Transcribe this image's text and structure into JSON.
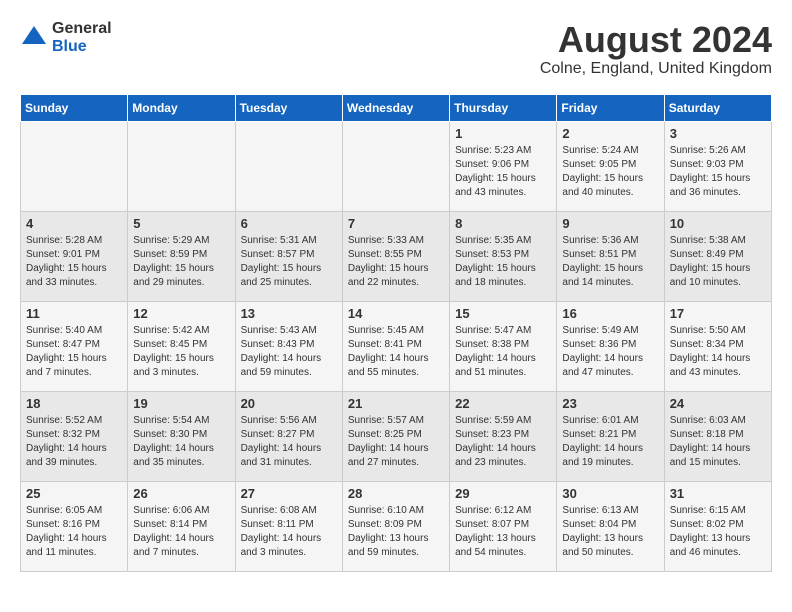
{
  "header": {
    "logo_general": "General",
    "logo_blue": "Blue",
    "month_year": "August 2024",
    "location": "Colne, England, United Kingdom"
  },
  "weekdays": [
    "Sunday",
    "Monday",
    "Tuesday",
    "Wednesday",
    "Thursday",
    "Friday",
    "Saturday"
  ],
  "weeks": [
    [
      {
        "day": "",
        "info": ""
      },
      {
        "day": "",
        "info": ""
      },
      {
        "day": "",
        "info": ""
      },
      {
        "day": "",
        "info": ""
      },
      {
        "day": "1",
        "info": "Sunrise: 5:23 AM\nSunset: 9:06 PM\nDaylight: 15 hours\nand 43 minutes."
      },
      {
        "day": "2",
        "info": "Sunrise: 5:24 AM\nSunset: 9:05 PM\nDaylight: 15 hours\nand 40 minutes."
      },
      {
        "day": "3",
        "info": "Sunrise: 5:26 AM\nSunset: 9:03 PM\nDaylight: 15 hours\nand 36 minutes."
      }
    ],
    [
      {
        "day": "4",
        "info": "Sunrise: 5:28 AM\nSunset: 9:01 PM\nDaylight: 15 hours\nand 33 minutes."
      },
      {
        "day": "5",
        "info": "Sunrise: 5:29 AM\nSunset: 8:59 PM\nDaylight: 15 hours\nand 29 minutes."
      },
      {
        "day": "6",
        "info": "Sunrise: 5:31 AM\nSunset: 8:57 PM\nDaylight: 15 hours\nand 25 minutes."
      },
      {
        "day": "7",
        "info": "Sunrise: 5:33 AM\nSunset: 8:55 PM\nDaylight: 15 hours\nand 22 minutes."
      },
      {
        "day": "8",
        "info": "Sunrise: 5:35 AM\nSunset: 8:53 PM\nDaylight: 15 hours\nand 18 minutes."
      },
      {
        "day": "9",
        "info": "Sunrise: 5:36 AM\nSunset: 8:51 PM\nDaylight: 15 hours\nand 14 minutes."
      },
      {
        "day": "10",
        "info": "Sunrise: 5:38 AM\nSunset: 8:49 PM\nDaylight: 15 hours\nand 10 minutes."
      }
    ],
    [
      {
        "day": "11",
        "info": "Sunrise: 5:40 AM\nSunset: 8:47 PM\nDaylight: 15 hours\nand 7 minutes."
      },
      {
        "day": "12",
        "info": "Sunrise: 5:42 AM\nSunset: 8:45 PM\nDaylight: 15 hours\nand 3 minutes."
      },
      {
        "day": "13",
        "info": "Sunrise: 5:43 AM\nSunset: 8:43 PM\nDaylight: 14 hours\nand 59 minutes."
      },
      {
        "day": "14",
        "info": "Sunrise: 5:45 AM\nSunset: 8:41 PM\nDaylight: 14 hours\nand 55 minutes."
      },
      {
        "day": "15",
        "info": "Sunrise: 5:47 AM\nSunset: 8:38 PM\nDaylight: 14 hours\nand 51 minutes."
      },
      {
        "day": "16",
        "info": "Sunrise: 5:49 AM\nSunset: 8:36 PM\nDaylight: 14 hours\nand 47 minutes."
      },
      {
        "day": "17",
        "info": "Sunrise: 5:50 AM\nSunset: 8:34 PM\nDaylight: 14 hours\nand 43 minutes."
      }
    ],
    [
      {
        "day": "18",
        "info": "Sunrise: 5:52 AM\nSunset: 8:32 PM\nDaylight: 14 hours\nand 39 minutes."
      },
      {
        "day": "19",
        "info": "Sunrise: 5:54 AM\nSunset: 8:30 PM\nDaylight: 14 hours\nand 35 minutes."
      },
      {
        "day": "20",
        "info": "Sunrise: 5:56 AM\nSunset: 8:27 PM\nDaylight: 14 hours\nand 31 minutes."
      },
      {
        "day": "21",
        "info": "Sunrise: 5:57 AM\nSunset: 8:25 PM\nDaylight: 14 hours\nand 27 minutes."
      },
      {
        "day": "22",
        "info": "Sunrise: 5:59 AM\nSunset: 8:23 PM\nDaylight: 14 hours\nand 23 minutes."
      },
      {
        "day": "23",
        "info": "Sunrise: 6:01 AM\nSunset: 8:21 PM\nDaylight: 14 hours\nand 19 minutes."
      },
      {
        "day": "24",
        "info": "Sunrise: 6:03 AM\nSunset: 8:18 PM\nDaylight: 14 hours\nand 15 minutes."
      }
    ],
    [
      {
        "day": "25",
        "info": "Sunrise: 6:05 AM\nSunset: 8:16 PM\nDaylight: 14 hours\nand 11 minutes."
      },
      {
        "day": "26",
        "info": "Sunrise: 6:06 AM\nSunset: 8:14 PM\nDaylight: 14 hours\nand 7 minutes."
      },
      {
        "day": "27",
        "info": "Sunrise: 6:08 AM\nSunset: 8:11 PM\nDaylight: 14 hours\nand 3 minutes."
      },
      {
        "day": "28",
        "info": "Sunrise: 6:10 AM\nSunset: 8:09 PM\nDaylight: 13 hours\nand 59 minutes."
      },
      {
        "day": "29",
        "info": "Sunrise: 6:12 AM\nSunset: 8:07 PM\nDaylight: 13 hours\nand 54 minutes."
      },
      {
        "day": "30",
        "info": "Sunrise: 6:13 AM\nSunset: 8:04 PM\nDaylight: 13 hours\nand 50 minutes."
      },
      {
        "day": "31",
        "info": "Sunrise: 6:15 AM\nSunset: 8:02 PM\nDaylight: 13 hours\nand 46 minutes."
      }
    ]
  ]
}
